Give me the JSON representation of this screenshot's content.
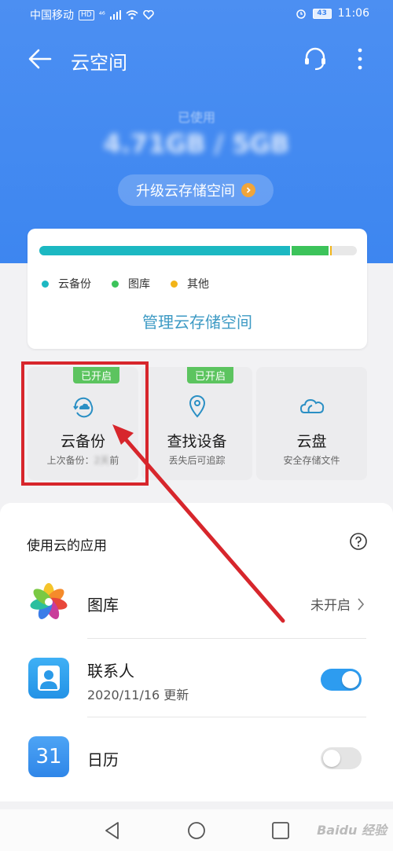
{
  "status_bar": {
    "carrier": "中国移动",
    "hd": "HD",
    "signal": "⁴⁶",
    "battery": "43",
    "time": "11:06"
  },
  "header": {
    "title": "云空间",
    "used_label": "已使用",
    "used_value": "4.71GB / 5GB",
    "upgrade_label": "升级云存储空间"
  },
  "storage": {
    "usage": [
      {
        "name": "云备份",
        "fraction": 0.79,
        "color": "#1cb8c2"
      },
      {
        "name": "图库",
        "fraction": 0.12,
        "color": "#3cc35a"
      },
      {
        "name": "其他",
        "fraction": 0.01,
        "color": "#f2b418"
      }
    ],
    "manage_label": "管理云存储空间"
  },
  "features": [
    {
      "title": "云备份",
      "subtitle_prefix": "上次备份：",
      "subtitle_blur": "2天",
      "subtitle_suffix": "前",
      "badge": "已开启"
    },
    {
      "title": "查找设备",
      "subtitle": "丢失后可追踪",
      "badge": "已开启"
    },
    {
      "title": "云盘",
      "subtitle": "安全存储文件"
    }
  ],
  "apps_section": {
    "title": "使用云的应用",
    "apps": [
      {
        "name": "图库",
        "status": "未开启"
      },
      {
        "name": "联系人",
        "subtitle": "2020/11/16 更新",
        "enabled": true
      },
      {
        "name": "日历",
        "icon_text": "31",
        "enabled": false
      }
    ]
  },
  "watermark": "Baidu 经验",
  "colors": {
    "primary": "#3d86f0",
    "accent_teal": "#3d9ac4",
    "badge_green": "#5cc45f",
    "annotation_red": "#d7262c",
    "toggle_on": "#2d9cf0"
  }
}
